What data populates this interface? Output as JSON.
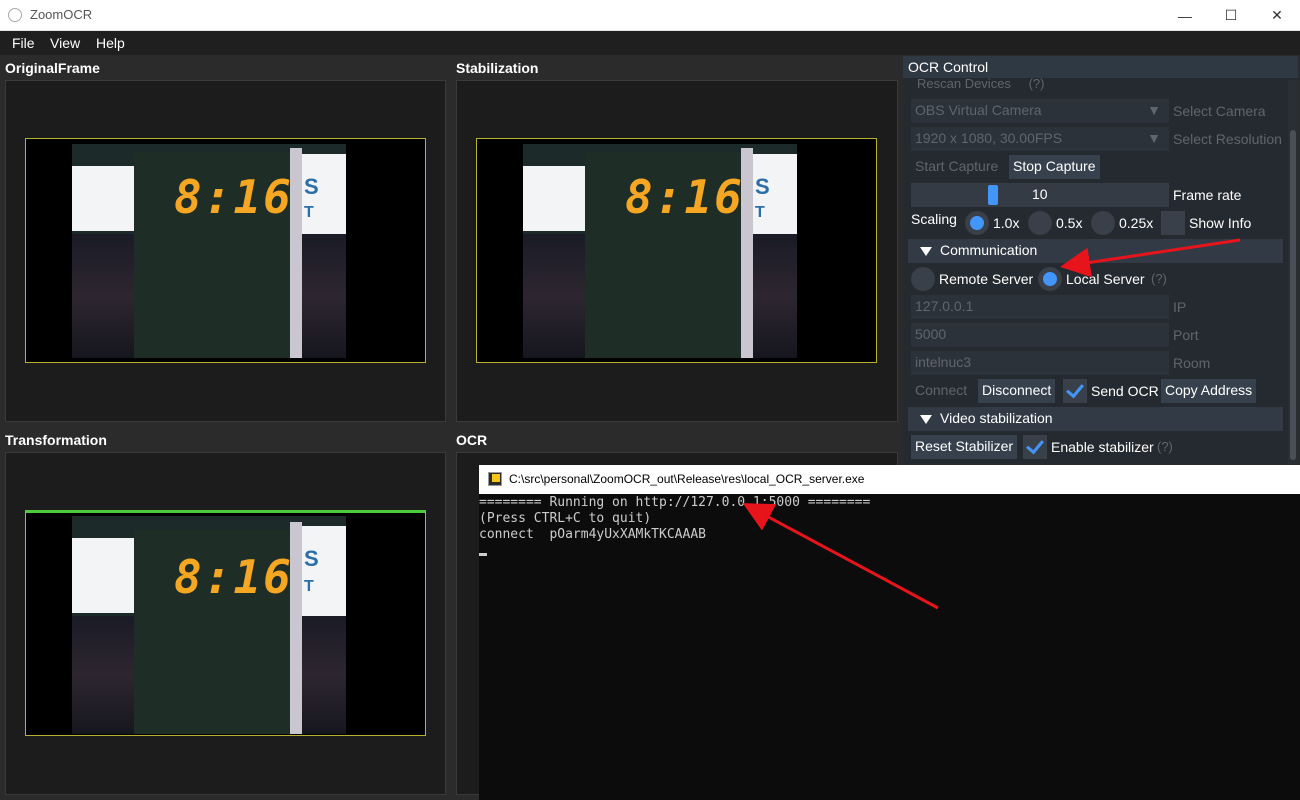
{
  "window": {
    "title": "ZoomOCR",
    "controls": {
      "minimize": "—",
      "maximize": "☐",
      "close": "✕"
    }
  },
  "menu": [
    "File",
    "View",
    "Help"
  ],
  "panels": {
    "original": "OriginalFrame",
    "stabilization": "Stabilization",
    "transformation": "Transformation",
    "ocr": "OCR"
  },
  "scoreboard": {
    "clock": "8:16",
    "partial_logo_top": "S",
    "partial_logo_bottom": "T"
  },
  "ocr_control": {
    "title": "OCR Control",
    "rescan_label": "Rescan Devices",
    "help": "(?)",
    "camera_value": "OBS Virtual Camera",
    "camera_label": "Select Camera",
    "resolution_value": "1920 x 1080, 30.00FPS",
    "resolution_label": "Select Resolution",
    "start_capture": "Start Capture",
    "stop_capture": "Stop Capture",
    "frame_rate_value": "10",
    "frame_rate_label": "Frame rate",
    "scaling_label": "Scaling",
    "scale_options": [
      "1.0x",
      "0.5x",
      "0.25x"
    ],
    "show_info": "Show Info",
    "communication": "Communication",
    "remote_server": "Remote Server",
    "local_server": "Local Server",
    "ip_value": "127.0.0.1",
    "ip_label": "IP",
    "port_value": "5000",
    "port_label": "Port",
    "room_value": "intelnuc3",
    "room_label": "Room",
    "connect": "Connect",
    "disconnect": "Disconnect",
    "send_ocr": "Send OCR",
    "copy_address": "Copy Address",
    "video_stabilization": "Video stabilization",
    "reset_stabilizer": "Reset Stabilizer",
    "enable_stabilizer": "Enable stabilizer"
  },
  "console": {
    "title": "C:\\src\\personal\\ZoomOCR_out\\Release\\res\\local_OCR_server.exe",
    "lines": [
      "======== Running on http://127.0.0.1:5000 ========",
      "(Press CTRL+C to quit)",
      "connect  pOarm4yUxXAMkTKCAAAB"
    ]
  },
  "colors": {
    "accent": "#4296fa",
    "annotation_arrow": "#e8141c",
    "frame_border": "#b9b030",
    "frame_border_active": "#4ccc3c",
    "digits": "#f5a623"
  }
}
